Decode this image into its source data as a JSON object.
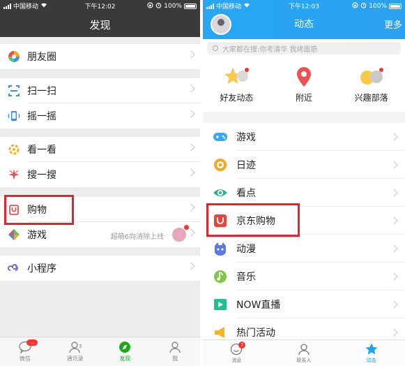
{
  "left": {
    "status": {
      "carrier": "中国移动",
      "time": "下午12:02",
      "battery": "100%"
    },
    "header": {
      "title": "发现"
    },
    "items": [
      {
        "label": "朋友圈"
      },
      {
        "label": "扫一扫"
      },
      {
        "label": "摇一摇"
      },
      {
        "label": "看一看"
      },
      {
        "label": "搜一搜"
      },
      {
        "label": "购物"
      },
      {
        "label": "游戏",
        "note": "超萌6向消除上线"
      },
      {
        "label": "小程序"
      }
    ],
    "tabs": [
      {
        "label": "微信",
        "badge": "…"
      },
      {
        "label": "通讯录"
      },
      {
        "label": "发现"
      },
      {
        "label": "我"
      }
    ]
  },
  "right": {
    "status": {
      "carrier": "中国移动",
      "time": "下午12:03",
      "battery": "100%"
    },
    "header": {
      "title": "动态",
      "more": "更多"
    },
    "search": {
      "placeholder": "大家都在搜:你考清华 我烤面筋"
    },
    "quick": [
      {
        "label": "好友动态"
      },
      {
        "label": "附近"
      },
      {
        "label": "兴趣部落"
      }
    ],
    "items": [
      {
        "label": "游戏"
      },
      {
        "label": "日迹"
      },
      {
        "label": "看点"
      },
      {
        "label": "京东购物"
      },
      {
        "label": "动漫"
      },
      {
        "label": "音乐"
      },
      {
        "label": "NOW直播"
      },
      {
        "label": "热门活动"
      }
    ],
    "tabs": [
      {
        "label": "消息",
        "badge": "7"
      },
      {
        "label": "联系人"
      },
      {
        "label": "动态"
      }
    ]
  },
  "colors": {
    "wechat_green": "#1aad19",
    "qq_blue": "#27a6f4",
    "highlight_red": "#e8222b"
  }
}
